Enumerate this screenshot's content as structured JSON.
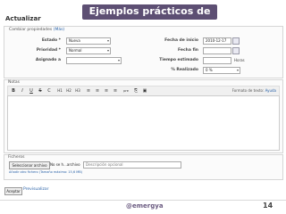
{
  "slide": {
    "title": "Ejemplos prácticos de uso",
    "handle": "@emergya",
    "page_number": "14"
  },
  "page_title": "Actualizar",
  "attributes": {
    "legend": "Cambiar propiedades",
    "legend_link": "(Más)",
    "status": {
      "label": "Estado *",
      "value": "Nueva"
    },
    "priority": {
      "label": "Prioridad *",
      "value": "Normal"
    },
    "assignee": {
      "label": "Asignado a",
      "value": ""
    },
    "start_date": {
      "label": "Fecha de inicio",
      "value": "2010-12-17"
    },
    "due_date": {
      "label": "Fecha fin",
      "value": ""
    },
    "estimated": {
      "label": "Tiempo estimado",
      "value": "",
      "unit": "Horas"
    },
    "done": {
      "label": "% Realizado",
      "value": "0 %"
    }
  },
  "notes": {
    "legend": "Notas",
    "toolbar": [
      "B",
      "I",
      "U",
      "S",
      "C",
      "H1",
      "H2",
      "H3",
      "≡",
      "≡",
      "≡",
      "≡",
      "pre",
      "⎘",
      "▣"
    ],
    "format_label": "Formato de texto:",
    "format_link": "Ayuda"
  },
  "files": {
    "legend": "Ficheros",
    "choose_button": "Seleccionar archivo",
    "no_file": "No se h...archivo",
    "description_placeholder": "Descripción opcional",
    "add_file": "Añadir otro fichero (Tamaño máximo: 15,6 MB)"
  },
  "actions": {
    "accept": "Aceptar",
    "preview": "Previsualizar"
  }
}
